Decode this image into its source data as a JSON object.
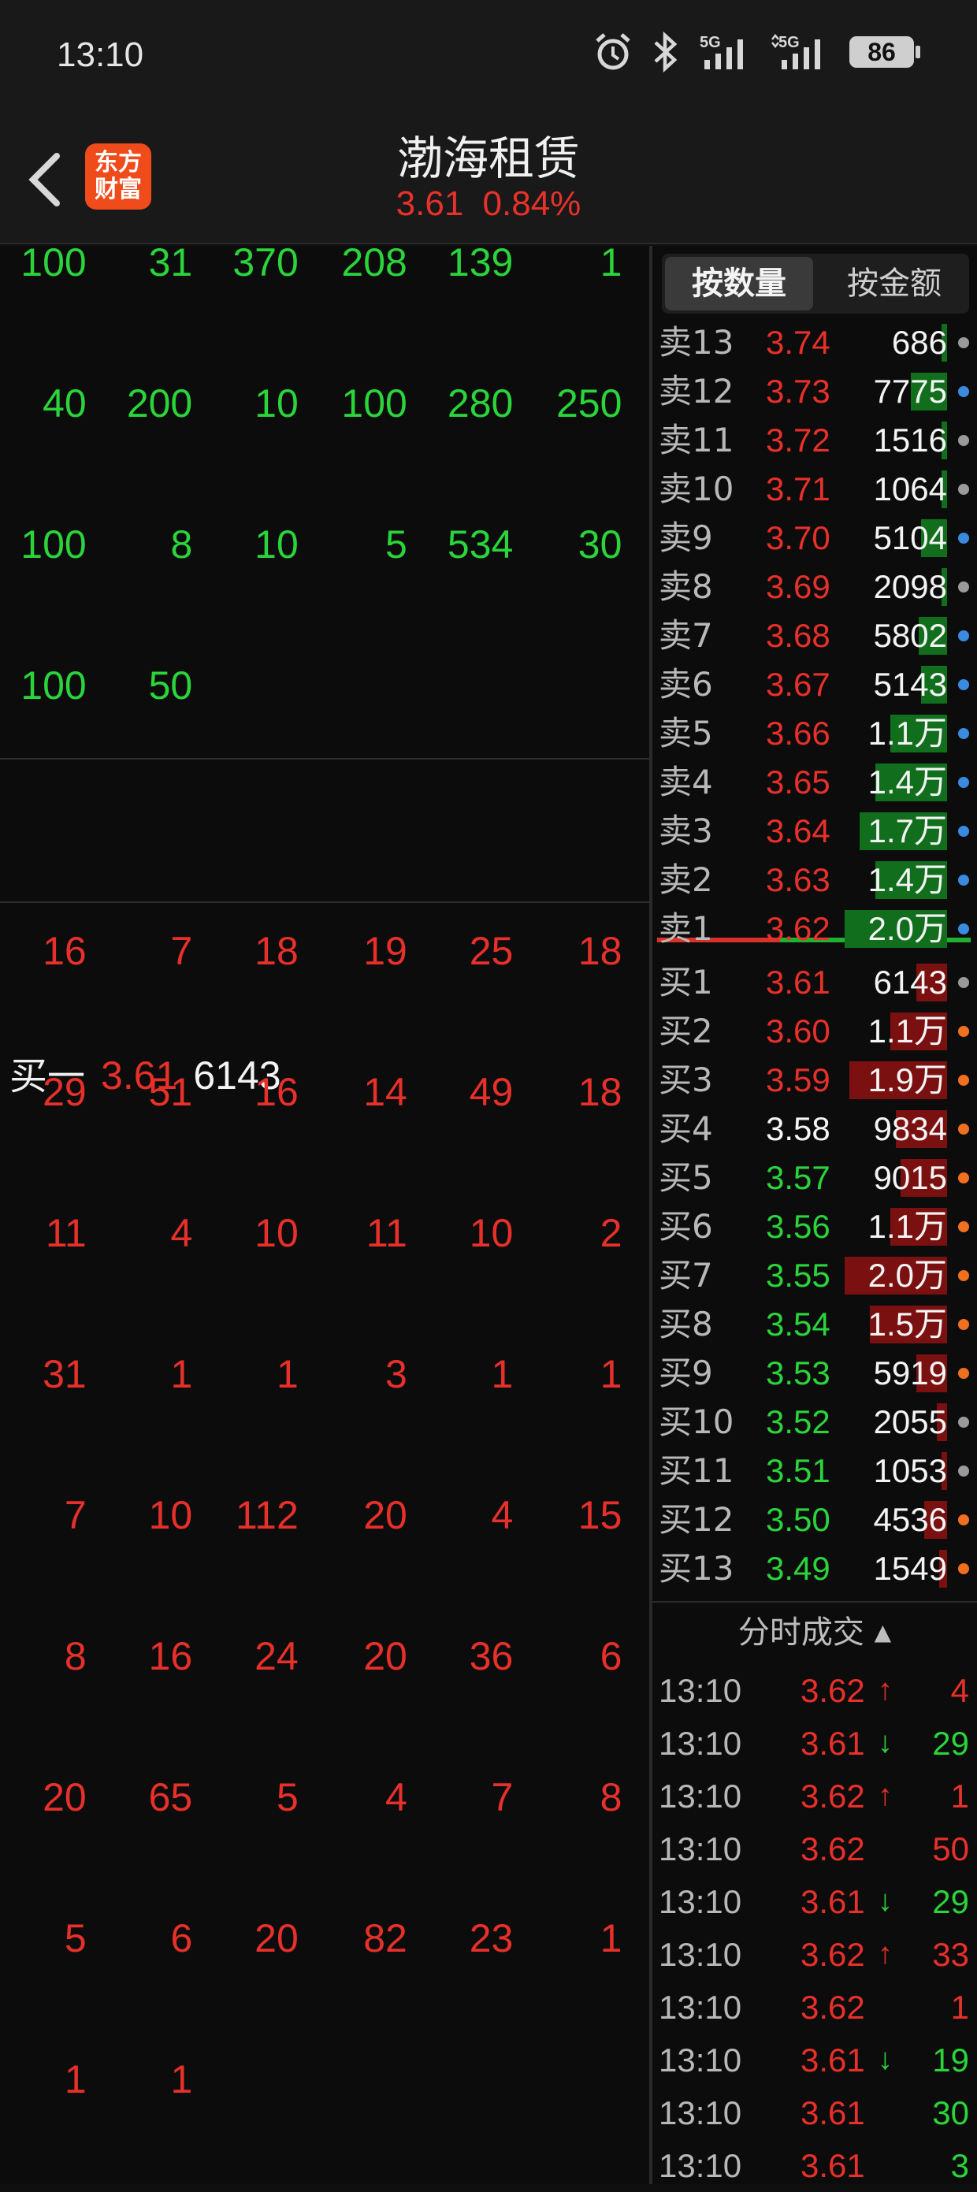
{
  "status_bar": {
    "time": "13:10",
    "icons": [
      "alarm-icon",
      "bluetooth-icon",
      "5g-signal-icon",
      "5g-signal-icon"
    ],
    "battery": "86"
  },
  "header": {
    "logo_line1": "东方",
    "logo_line2": "财富",
    "title": "渤海租赁",
    "price": "3.61",
    "change": "0.84%"
  },
  "sell_blocks": [
    [
      "100",
      "31",
      "370",
      "208",
      "139",
      "1"
    ],
    [
      "40",
      "200",
      "10",
      "100",
      "280",
      "250"
    ],
    [
      "100",
      "8",
      "10",
      "5",
      "534",
      "30"
    ],
    [
      "100",
      "50"
    ]
  ],
  "buy_one": {
    "label": "买一",
    "price": "3.61",
    "volume": "6143"
  },
  "buy_blocks": [
    [
      "16",
      "7",
      "18",
      "19",
      "25",
      "18"
    ],
    [
      "29",
      "51",
      "16",
      "14",
      "49",
      "18"
    ],
    [
      "11",
      "4",
      "10",
      "11",
      "10",
      "2"
    ],
    [
      "31",
      "1",
      "1",
      "3",
      "1",
      "1"
    ],
    [
      "7",
      "10",
      "112",
      "20",
      "4",
      "15"
    ],
    [
      "8",
      "16",
      "24",
      "20",
      "36",
      "6"
    ],
    [
      "20",
      "65",
      "5",
      "4",
      "7",
      "8"
    ],
    [
      "5",
      "6",
      "20",
      "82",
      "23",
      "1"
    ],
    [
      "1",
      "1"
    ]
  ],
  "tabs": {
    "by_quantity": "按数量",
    "by_amount": "按金额"
  },
  "asks": [
    {
      "label": "卖13",
      "price": "3.74",
      "qty": "686",
      "fill": 0.05,
      "dot": "#9a9a9a"
    },
    {
      "label": "卖12",
      "price": "3.73",
      "qty": "7775",
      "fill": 0.35,
      "dot": "#3a8be0"
    },
    {
      "label": "卖11",
      "price": "3.72",
      "qty": "1516",
      "fill": 0.05,
      "dot": "#9a9a9a"
    },
    {
      "label": "卖10",
      "price": "3.71",
      "qty": "1064",
      "fill": 0.05,
      "dot": "#9a9a9a"
    },
    {
      "label": "卖9",
      "price": "3.70",
      "qty": "5104",
      "fill": 0.25,
      "dot": "#3a8be0"
    },
    {
      "label": "卖8",
      "price": "3.69",
      "qty": "2098",
      "fill": 0.05,
      "dot": "#9a9a9a"
    },
    {
      "label": "卖7",
      "price": "3.68",
      "qty": "5802",
      "fill": 0.28,
      "dot": "#3a8be0"
    },
    {
      "label": "卖6",
      "price": "3.67",
      "qty": "5143",
      "fill": 0.25,
      "dot": "#3a8be0"
    },
    {
      "label": "卖5",
      "price": "3.66",
      "qty": "1.1万",
      "fill": 0.55,
      "dot": "#3a8be0"
    },
    {
      "label": "卖4",
      "price": "3.65",
      "qty": "1.4万",
      "fill": 0.7,
      "dot": "#3a8be0"
    },
    {
      "label": "卖3",
      "price": "3.64",
      "qty": "1.7万",
      "fill": 0.85,
      "dot": "#3a8be0"
    },
    {
      "label": "卖2",
      "price": "3.63",
      "qty": "1.4万",
      "fill": 0.7,
      "dot": "#3a8be0"
    },
    {
      "label": "卖1",
      "price": "3.62",
      "qty": "2.0万",
      "fill": 1.0,
      "dot": "#3a8be0"
    }
  ],
  "bids": [
    {
      "label": "买1",
      "price": "3.61",
      "qty": "6143",
      "fill": 0.3,
      "dot": "#9a9a9a",
      "pcolor": "red"
    },
    {
      "label": "买2",
      "price": "3.60",
      "qty": "1.1万",
      "fill": 0.55,
      "dot": "#f07020",
      "pcolor": "red"
    },
    {
      "label": "买3",
      "price": "3.59",
      "qty": "1.9万",
      "fill": 0.95,
      "dot": "#f07020",
      "pcolor": "red"
    },
    {
      "label": "买4",
      "price": "3.58",
      "qty": "9834",
      "fill": 0.5,
      "dot": "#f07020",
      "pcolor": "white"
    },
    {
      "label": "买5",
      "price": "3.57",
      "qty": "9015",
      "fill": 0.45,
      "dot": "#f07020",
      "pcolor": "green"
    },
    {
      "label": "买6",
      "price": "3.56",
      "qty": "1.1万",
      "fill": 0.55,
      "dot": "#f07020",
      "pcolor": "green"
    },
    {
      "label": "买7",
      "price": "3.55",
      "qty": "2.0万",
      "fill": 1.0,
      "dot": "#f07020",
      "pcolor": "green"
    },
    {
      "label": "买8",
      "price": "3.54",
      "qty": "1.5万",
      "fill": 0.75,
      "dot": "#f07020",
      "pcolor": "green"
    },
    {
      "label": "买9",
      "price": "3.53",
      "qty": "5919",
      "fill": 0.3,
      "dot": "#f07020",
      "pcolor": "green"
    },
    {
      "label": "买10",
      "price": "3.52",
      "qty": "2055",
      "fill": 0.1,
      "dot": "#9a9a9a",
      "pcolor": "green"
    },
    {
      "label": "买11",
      "price": "3.51",
      "qty": "1053",
      "fill": 0.05,
      "dot": "#9a9a9a",
      "pcolor": "green"
    },
    {
      "label": "买12",
      "price": "3.50",
      "qty": "4536",
      "fill": 0.22,
      "dot": "#f07020",
      "pcolor": "green"
    },
    {
      "label": "买13",
      "price": "3.49",
      "qty": "1549",
      "fill": 0.08,
      "dot": "#f07020",
      "pcolor": "green"
    }
  ],
  "timeshare": {
    "title": "分时成交",
    "title_icon": "triangle-up-icon",
    "rows": [
      {
        "time": "13:10",
        "price": "3.62",
        "arrow": "↑",
        "vol": "4",
        "dir": "up"
      },
      {
        "time": "13:10",
        "price": "3.61",
        "arrow": "↓",
        "vol": "29",
        "dir": "down"
      },
      {
        "time": "13:10",
        "price": "3.62",
        "arrow": "↑",
        "vol": "1",
        "dir": "up"
      },
      {
        "time": "13:10",
        "price": "3.62",
        "arrow": "",
        "vol": "50",
        "dir": "up"
      },
      {
        "time": "13:10",
        "price": "3.61",
        "arrow": "↓",
        "vol": "29",
        "dir": "down"
      },
      {
        "time": "13:10",
        "price": "3.62",
        "arrow": "↑",
        "vol": "33",
        "dir": "up"
      },
      {
        "time": "13:10",
        "price": "3.62",
        "arrow": "",
        "vol": "1",
        "dir": "up"
      },
      {
        "time": "13:10",
        "price": "3.61",
        "arrow": "↓",
        "vol": "19",
        "dir": "down"
      },
      {
        "time": "13:10",
        "price": "3.61",
        "arrow": "",
        "vol": "30",
        "dir": "down"
      },
      {
        "time": "13:10",
        "price": "3.61",
        "arrow": "",
        "vol": "3",
        "dir": "down"
      }
    ]
  },
  "colors": {
    "up": "#e8302a",
    "down": "#2ad43a",
    "ask_bar": "#116e1c",
    "bid_bar": "#7a1010"
  }
}
